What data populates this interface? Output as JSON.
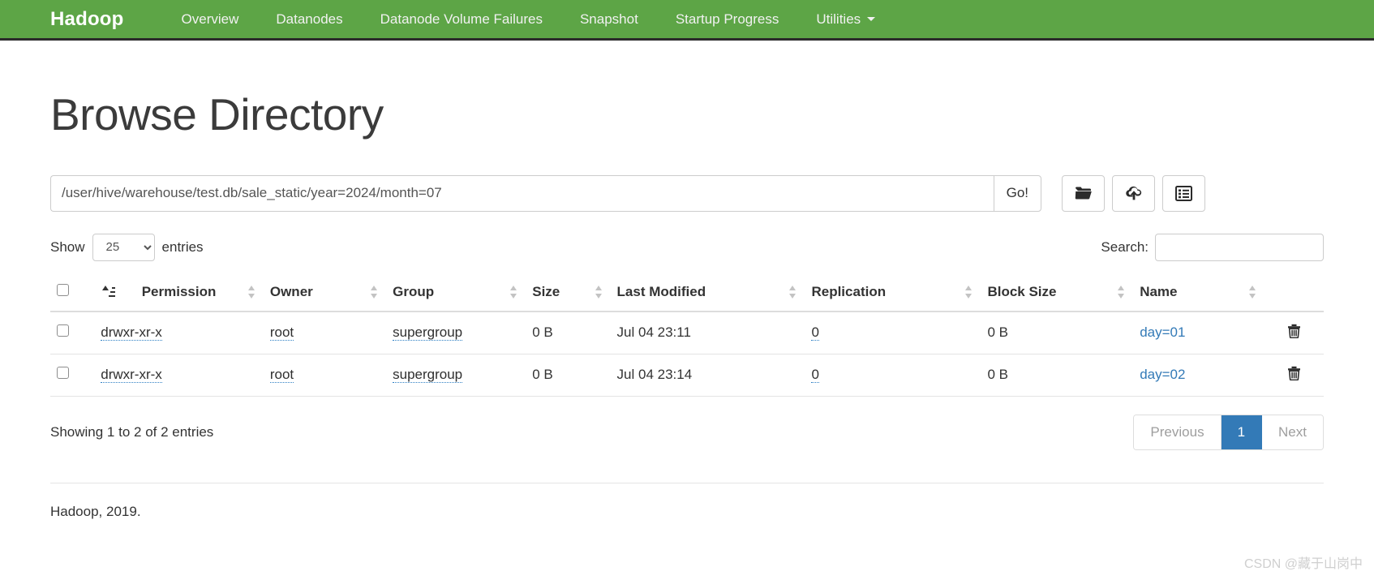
{
  "navbar": {
    "brand": "Hadoop",
    "items": [
      {
        "label": "Overview",
        "icon": "",
        "has_caret": false
      },
      {
        "label": "Datanodes",
        "icon": "",
        "has_caret": false
      },
      {
        "label": "Datanode Volume Failures",
        "icon": "",
        "has_caret": false
      },
      {
        "label": "Snapshot",
        "icon": "",
        "has_caret": false
      },
      {
        "label": "Startup Progress",
        "icon": "",
        "has_caret": false
      },
      {
        "label": "Utilities",
        "icon": "chevron-down-icon",
        "has_caret": true
      }
    ],
    "background_color": "#5DA546"
  },
  "page": {
    "title": "Browse Directory"
  },
  "path_bar": {
    "value": "/user/hive/warehouse/test.db/sale_static/year=2024/month=07",
    "placeholder": "Enter the directory path",
    "go_label": "Go!",
    "buttons": [
      {
        "name": "create-directory-button",
        "icon": "folder-open-icon"
      },
      {
        "name": "upload-files-button",
        "icon": "cloud-upload-icon"
      },
      {
        "name": "snapshot-button",
        "icon": "list-alt-icon"
      }
    ]
  },
  "table_controls": {
    "show_label": "Show",
    "entries_label": "entries",
    "page_length_selected": "25",
    "page_length_options": [
      "25",
      "50",
      "100"
    ],
    "search_label": "Search:",
    "search_value": "",
    "search_placeholder": ""
  },
  "table": {
    "columns": [
      {
        "key": "check",
        "label": "",
        "sort": "none"
      },
      {
        "key": "blank",
        "label": "",
        "sort": "asc"
      },
      {
        "key": "perm",
        "label": "Permission",
        "sort": "both"
      },
      {
        "key": "owner",
        "label": "Owner",
        "sort": "both"
      },
      {
        "key": "group",
        "label": "Group",
        "sort": "both"
      },
      {
        "key": "size",
        "label": "Size",
        "sort": "both"
      },
      {
        "key": "mod",
        "label": "Last Modified",
        "sort": "both"
      },
      {
        "key": "repl",
        "label": "Replication",
        "sort": "both"
      },
      {
        "key": "block",
        "label": "Block Size",
        "sort": "both"
      },
      {
        "key": "name",
        "label": "Name",
        "sort": "both"
      },
      {
        "key": "trash",
        "label": "",
        "sort": "none"
      }
    ],
    "rows": [
      {
        "permission": "drwxr-xr-x",
        "owner": "root",
        "group": "supergroup",
        "size": "0 B",
        "last_modified": "Jul 04 23:11",
        "replication": "0",
        "block_size": "0 B",
        "name": "day=01",
        "delete_icon": "trash-icon"
      },
      {
        "permission": "drwxr-xr-x",
        "owner": "root",
        "group": "supergroup",
        "size": "0 B",
        "last_modified": "Jul 04 23:14",
        "replication": "0",
        "block_size": "0 B",
        "name": "day=02",
        "delete_icon": "trash-icon"
      }
    ]
  },
  "table_footer": {
    "info": "Showing 1 to 2 of 2 entries",
    "pagination": {
      "previous": "Previous",
      "pages": [
        "1"
      ],
      "next": "Next",
      "active_page": "1",
      "active_color": "#337ab7"
    }
  },
  "footer": {
    "text": "Hadoop, 2019."
  },
  "watermark": {
    "text": "CSDN @藏于山岗中"
  }
}
